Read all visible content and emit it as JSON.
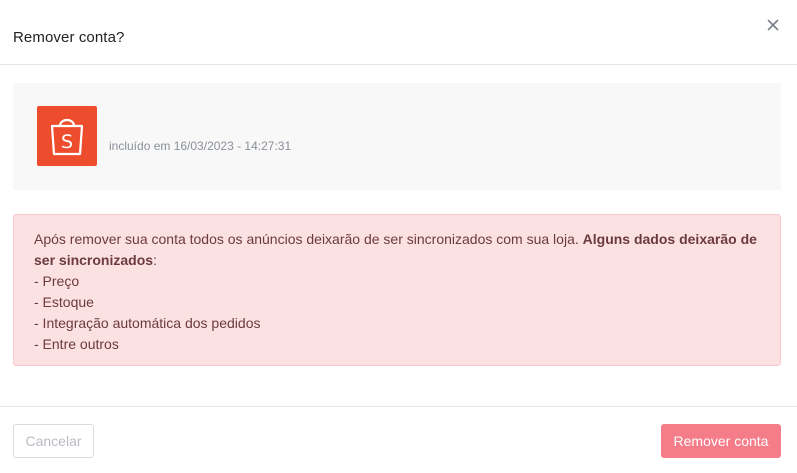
{
  "modal": {
    "title": "Remover conta?",
    "close_icon": "close-icon"
  },
  "account": {
    "logo_icon": "shopee-bag-icon",
    "logo_color": "#ee4d2d",
    "included_text": "incluído em 16/03/2023 - 14:27:31"
  },
  "alert": {
    "intro": "Após remover sua conta todos os anúncios deixarão de ser sincronizados com sua loja. ",
    "bold": "Alguns dados deixarão de ser sincronizados",
    "colon": ":",
    "items": [
      "- Preço",
      "- Estoque",
      "- Integração automática dos pedidos",
      "- Entre outros"
    ],
    "background_color": "#fce1e3",
    "text_color": "#6b3a3f"
  },
  "footer": {
    "cancel_label": "Cancelar",
    "remove_label": "Remover conta",
    "remove_color": "#f57c89"
  }
}
